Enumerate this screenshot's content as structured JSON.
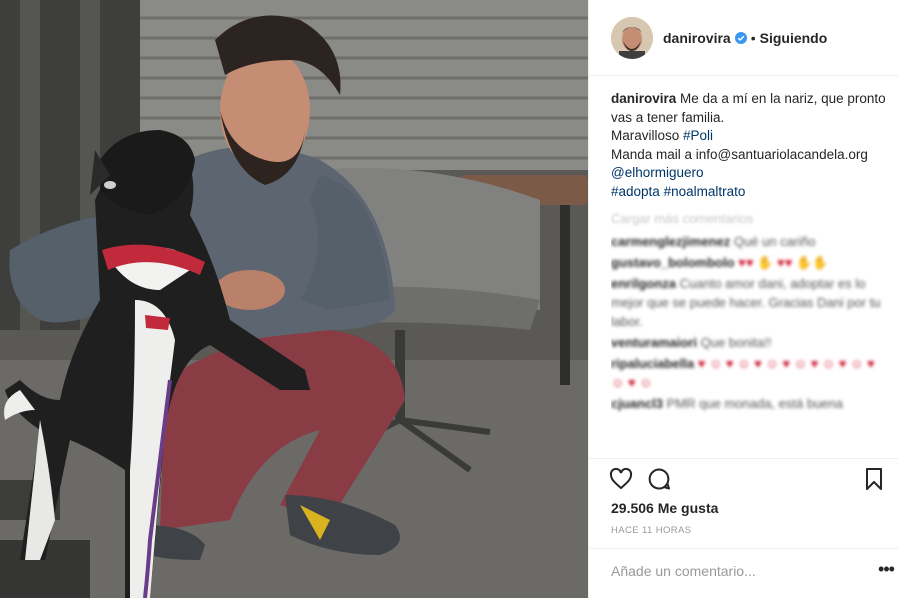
{
  "header": {
    "username": "danirovira",
    "separator": "•",
    "follow_status": "Siguiendo"
  },
  "caption": {
    "username": "danirovira",
    "line1": "Me da a mí en la nariz, que pronto vas a tener familia.",
    "line2_text": "Maravilloso ",
    "line2_tag": "#Poli",
    "line3": "Manda mail a info@santuariolacandela.org",
    "mention": "@elhormiguero",
    "tag1": "#adopta",
    "tag2": "#noalmaltrato"
  },
  "comments": {
    "load_more": "Cargar más comentarios"
  },
  "blurred_comments": [
    {
      "user": "carmenglezjimenez",
      "text": "Qué un cariño"
    },
    {
      "user": "gustavo_bolombolo",
      "text": "♥♥ ✋ ♥♥ ✋✋"
    },
    {
      "user": "enrilgonza",
      "text": "Cuanto amor dani, adoptar es lo mejor que se puede hacer. Gracias Dani por tu labor."
    },
    {
      "user": "venturamaiori",
      "text": "Que bonita!!"
    },
    {
      "user": "ripaluciabella",
      "text": "♥ ☺ ♥ ☺ ♥ ☺ ♥ ☺ ♥ ☺ ♥ ☺ ♥ ☺ ♥ ☺"
    },
    {
      "user": "cjuancl3",
      "text": "PMR que monada, está buena"
    }
  ],
  "stats": {
    "likes": "29.506 Me gusta",
    "timestamp": "HACE 11 HORAS"
  },
  "composer": {
    "placeholder": "Añade un comentario...",
    "options": "•••"
  },
  "colors": {
    "link": "#003569",
    "verified": "#3897f0",
    "text": "#262626",
    "muted": "#999999"
  }
}
